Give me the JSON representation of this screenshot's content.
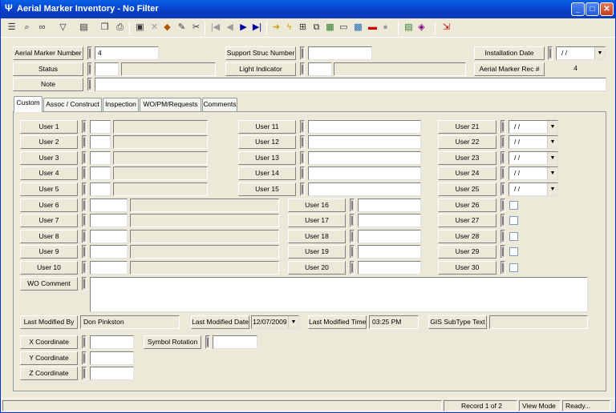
{
  "window": {
    "title": "Aerial Marker Inventory - No Filter"
  },
  "toolbar": {
    "icons": [
      "list-icon",
      "find-icon",
      "binoculars-icon",
      "filter-icon",
      "report-icon",
      "copy-icon",
      "print-icon",
      "save-icon",
      "delete-icon",
      "spray-icon",
      "pencil-icon",
      "scissors-icon",
      "first-icon",
      "prev-icon",
      "next-icon",
      "last-icon",
      "arrow-right-icon",
      "lightning-icon",
      "tree-icon",
      "map-icon",
      "window-icon",
      "photo-icon",
      "car-icon",
      "globe-icon",
      "grid-icon",
      "book-icon",
      "exit-icon"
    ]
  },
  "header": {
    "aerial_marker_number": {
      "label": "Aerial Marker Number",
      "value": "4"
    },
    "status": {
      "label": "Status",
      "value": ""
    },
    "note": {
      "label": "Note",
      "value": ""
    },
    "support_struc_number": {
      "label": "Support Struc Number",
      "value": ""
    },
    "light_indicator": {
      "label": "Light Indicator",
      "value": ""
    },
    "installation_date": {
      "label": "Installation Date",
      "value": "/ /"
    },
    "aerial_marker_rec": {
      "label": "Aerial Marker Rec #",
      "value": "4"
    }
  },
  "tabs": [
    {
      "label": "Custom",
      "active": true
    },
    {
      "label": "Assoc / Construct"
    },
    {
      "label": "Inspection"
    },
    {
      "label": "WO/PM/Requests"
    },
    {
      "label": "Comments"
    }
  ],
  "custom": {
    "user_fields": [
      {
        "label": "User 1",
        "value": ""
      },
      {
        "label": "User 2",
        "value": ""
      },
      {
        "label": "User 3",
        "value": ""
      },
      {
        "label": "User 4",
        "value": ""
      },
      {
        "label": "User 5",
        "value": ""
      },
      {
        "label": "User 6",
        "value": ""
      },
      {
        "label": "User 7",
        "value": ""
      },
      {
        "label": "User 8",
        "value": ""
      },
      {
        "label": "User 9",
        "value": ""
      },
      {
        "label": "User 10",
        "value": ""
      },
      {
        "label": "User 11",
        "value": ""
      },
      {
        "label": "User 12",
        "value": ""
      },
      {
        "label": "User 13",
        "value": ""
      },
      {
        "label": "User 14",
        "value": ""
      },
      {
        "label": "User 15",
        "value": ""
      },
      {
        "label": "User 16",
        "value": ""
      },
      {
        "label": "User 17",
        "value": ""
      },
      {
        "label": "User 18",
        "value": ""
      },
      {
        "label": "User 19",
        "value": ""
      },
      {
        "label": "User 20",
        "value": ""
      },
      {
        "label": "User 21",
        "value": "/ /"
      },
      {
        "label": "User 22",
        "value": "/ /"
      },
      {
        "label": "User 23",
        "value": "/ /"
      },
      {
        "label": "User 24",
        "value": "/ /"
      },
      {
        "label": "User 25",
        "value": "/ /"
      },
      {
        "label": "User 26",
        "checked": false
      },
      {
        "label": "User 27",
        "checked": false
      },
      {
        "label": "User 28",
        "checked": false
      },
      {
        "label": "User 29",
        "checked": false
      },
      {
        "label": "User 30",
        "checked": false
      }
    ],
    "wo_comment": {
      "label": "WO Comment",
      "value": ""
    },
    "last_modified_by": {
      "label": "Last Modified By",
      "value": "Don Pinkston"
    },
    "last_modified_date": {
      "label": "Last Modified Date",
      "value": "12/07/2009"
    },
    "last_modified_time": {
      "label": "Last Modified Time",
      "value": "03:25 PM"
    },
    "gis_subtype_text": {
      "label": "GIS SubType Text",
      "value": ""
    },
    "x_coordinate": {
      "label": "X Coordinate",
      "value": ""
    },
    "y_coordinate": {
      "label": "Y Coordinate",
      "value": ""
    },
    "z_coordinate": {
      "label": "Z Coordinate",
      "value": ""
    },
    "symbol_rotation": {
      "label": "Symbol Rotation",
      "value": ""
    }
  },
  "statusbar": {
    "record": "Record 1 of 2",
    "mode": "View Mode",
    "state": "Ready..."
  }
}
